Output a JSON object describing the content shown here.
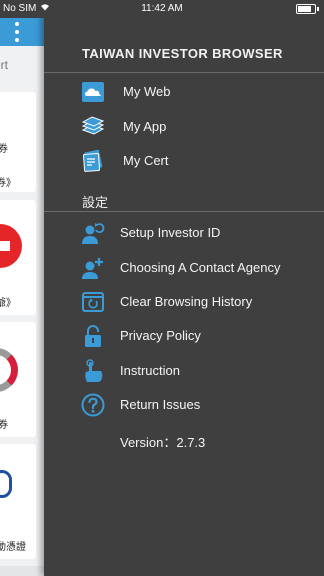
{
  "status_bar": {
    "carrier": "No SIM",
    "time": "11:42 AM",
    "battery_level": 0.8
  },
  "background": {
    "tab_fragment": "ert",
    "card_texts": [
      "券",
      "券》",
      "爺》",
      "券",
      "動憑證"
    ]
  },
  "drawer": {
    "title": "TAIWAN INVESTOR BROWSER",
    "top_items": [
      {
        "icon": "cloud-icon",
        "label": "My Web"
      },
      {
        "icon": "books-icon",
        "label": "My App"
      },
      {
        "icon": "certificate-icon",
        "label": "My Cert"
      }
    ],
    "section_label": "設定",
    "settings_items": [
      {
        "icon": "user-refresh-icon",
        "label": "Setup Investor ID"
      },
      {
        "icon": "user-add-icon",
        "label": "Choosing A Contact Agency"
      },
      {
        "icon": "clear-history-icon",
        "label": "Clear Browsing History"
      },
      {
        "icon": "unlock-icon",
        "label": "Privacy Policy"
      },
      {
        "icon": "tap-hand-icon",
        "label": "Instruction"
      },
      {
        "icon": "help-icon",
        "label": "Return Issues"
      }
    ],
    "version": "Version：2.7.3"
  },
  "colors": {
    "drawer_bg": "#3f3f3f",
    "accent": "#3b9bd7",
    "icon": "#3b9bd7"
  }
}
